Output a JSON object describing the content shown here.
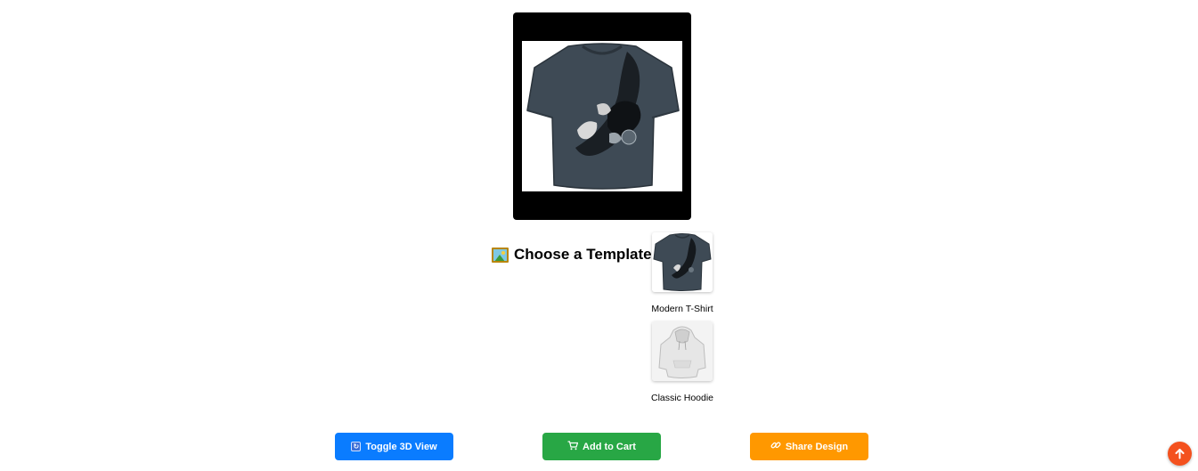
{
  "preview": {
    "image_label": "Modern T-Shirt"
  },
  "chooser": {
    "heading": "Choose a Template",
    "heading_icon": "framed-picture-icon",
    "templates": [
      {
        "label": "Modern T-Shirt",
        "icon": "tshirt-icon",
        "selected": true
      },
      {
        "label": "Classic Hoodie",
        "icon": "hoodie-icon",
        "selected": false
      }
    ]
  },
  "actions": {
    "toggle_3d": {
      "label": "Toggle 3D View",
      "icon": "refresh-icon",
      "color": "#0a7cff"
    },
    "add_to_cart": {
      "label": "Add to Cart",
      "icon": "cart-icon",
      "color": "#28a745"
    },
    "share": {
      "label": "Share Design",
      "icon": "link-icon",
      "color": "#ff9800"
    }
  },
  "scroll_top": {
    "icon": "arrow-up-icon",
    "color": "#f4511e"
  }
}
